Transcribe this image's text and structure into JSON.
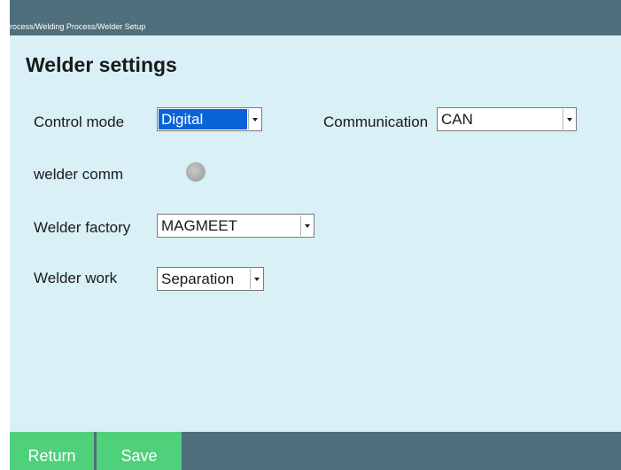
{
  "breadcrumb": "rocess/Welding Process/Welder Setup",
  "title": "Welder settings",
  "form": {
    "control_mode": {
      "label": "Control mode",
      "value": "Digital"
    },
    "communication": {
      "label": "Communication",
      "value": "CAN"
    },
    "welder_comm": {
      "label": "welder comm",
      "indicator_state": "off",
      "indicator_color": "#b0b0b0"
    },
    "welder_factory": {
      "label": "Welder factory",
      "value": "MAGMEET"
    },
    "welder_work": {
      "label": "Welder work",
      "value": "Separation"
    }
  },
  "footer": {
    "return_label": "Return",
    "save_label": "Save"
  },
  "colors": {
    "header": "#4e6f7b",
    "panel": "#d8f0f6",
    "button": "#4fd07a",
    "selection": "#0a64d8"
  }
}
